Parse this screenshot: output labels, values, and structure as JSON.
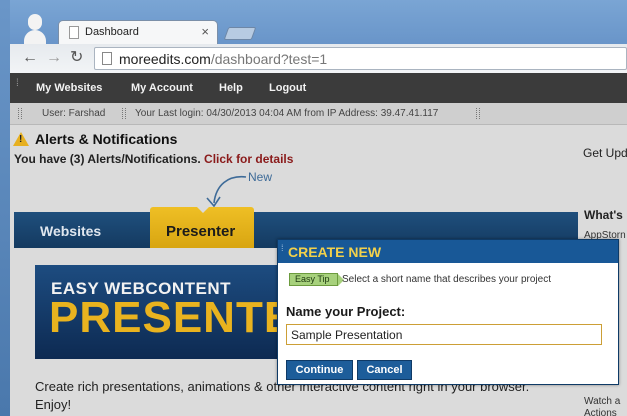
{
  "browser": {
    "tab_title": "Dashboard",
    "tab_close": "×",
    "url_domain": "moreedits.com",
    "url_path": "/dashboard?test=1",
    "back": "←",
    "forward": "→",
    "reload": "↻"
  },
  "nav": {
    "items": [
      "My Websites",
      "My Account",
      "Help",
      "Logout"
    ]
  },
  "userbar": {
    "user": "User: Farshad",
    "last_login": "Your Last login: 04/30/2013 04:04 AM from IP Address: 39.47.41.117"
  },
  "alerts": {
    "title": "Alerts & Notifications",
    "count_text": "You have (3) Alerts/Notifications.",
    "link_text": "Click for details",
    "new_label": "New"
  },
  "sidebar": {
    "get_updates": "Get Upd",
    "whats": "What's",
    "appstore": "AppStorn",
    "watch_line1": "Watch a",
    "watch_line2": "Actions"
  },
  "tabs": {
    "websites": "Websites",
    "presenter": "Presenter"
  },
  "banner": {
    "line1": "EASY WEBCONTENT",
    "line2": "PRESENTER"
  },
  "description": "Create rich presentations, animations & other interactive content right in your browser. Enjoy!",
  "modal": {
    "title": "CREATE NEW",
    "tip_badge": "Easy Tip",
    "tip_text": "Select a short name that describes your project",
    "label": "Name your Project:",
    "input_value": "Sample Presentation",
    "continue": "Continue",
    "cancel": "Cancel"
  },
  "colors": {
    "nav_bg": "#3b3b3b",
    "tab_bar": "#1f4f7d",
    "presenter_tab": "#e2b01a",
    "modal_header": "#185897",
    "modal_title": "#f3d14b"
  }
}
